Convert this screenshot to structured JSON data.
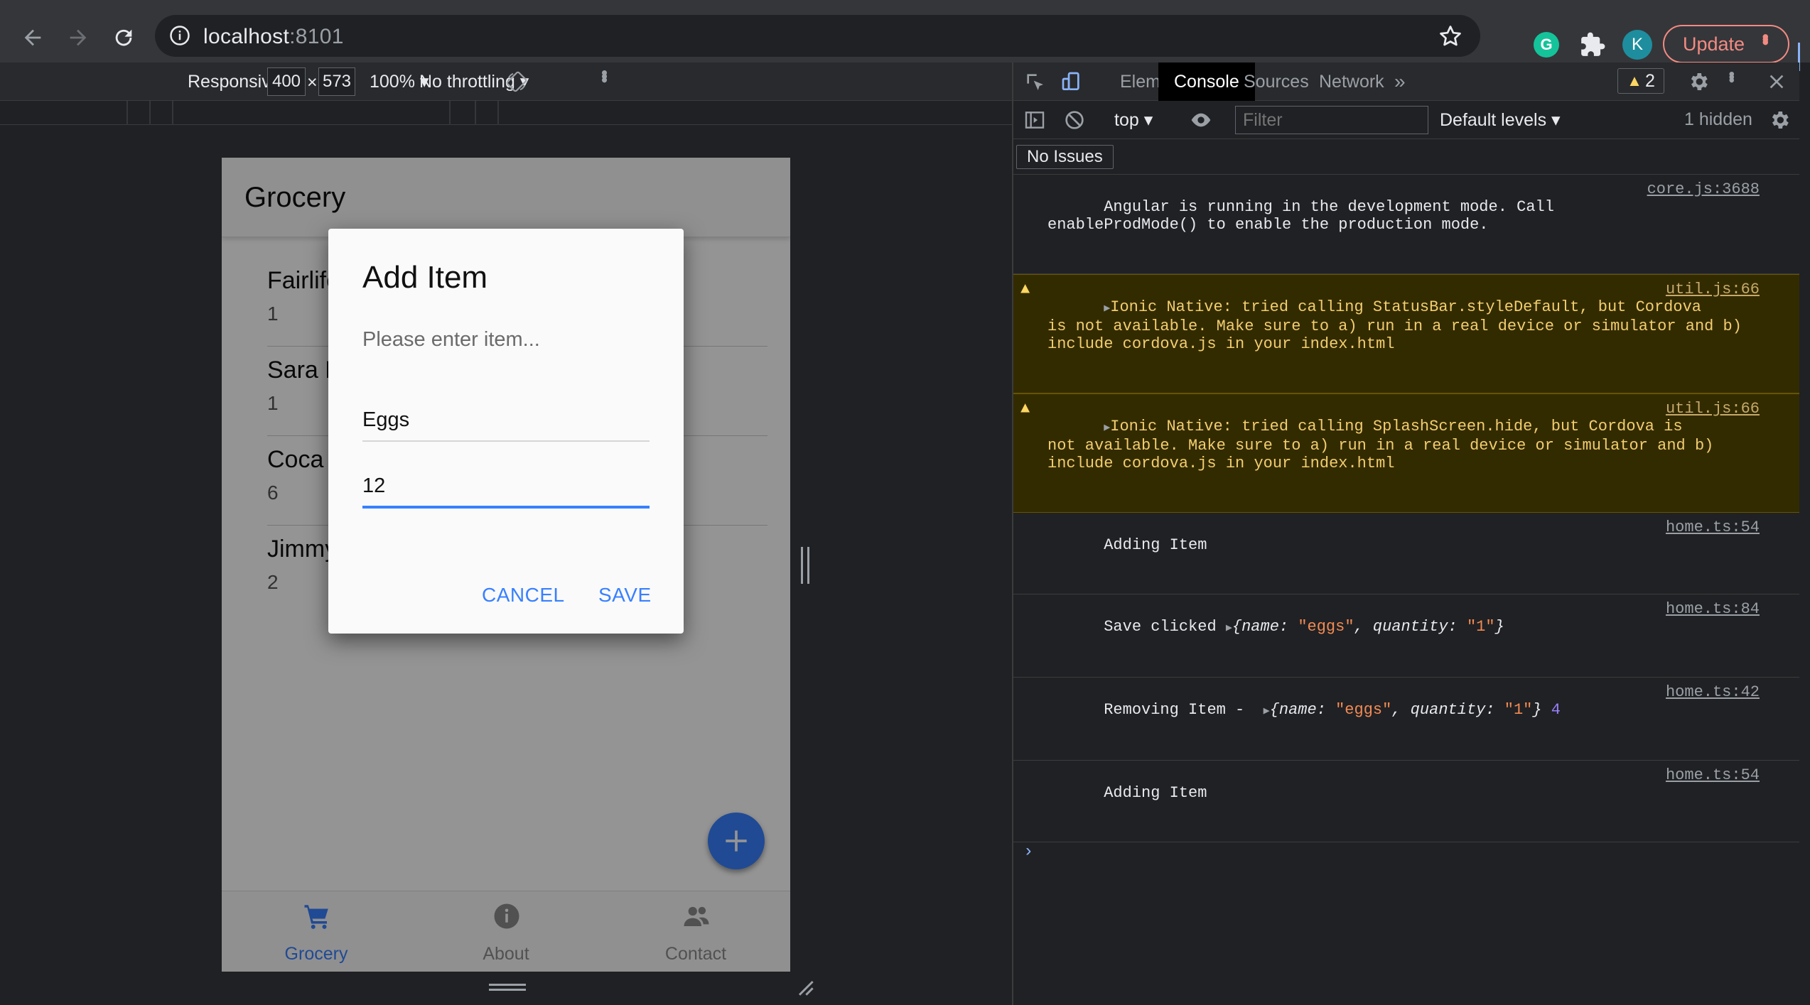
{
  "browser": {
    "url_host": "localhost",
    "url_port": ":8101",
    "extension_grammarly": "G",
    "profile_initial": "K",
    "update_label": "Update"
  },
  "device_toolbar": {
    "mode": "Responsive",
    "width": "400",
    "height": "573",
    "times": "×",
    "zoom": "100%",
    "throttling": "No throttling"
  },
  "app": {
    "title": "Grocery",
    "items": [
      {
        "name": "Fairlife",
        "qty": "1"
      },
      {
        "name": "Sara L",
        "qty": "1"
      },
      {
        "name": "Coca C",
        "qty": "6"
      },
      {
        "name": "Jimmy",
        "qty": "2"
      }
    ],
    "tabs": [
      {
        "label": "Grocery",
        "icon": "cart-icon",
        "active": true
      },
      {
        "label": "About",
        "icon": "info-icon",
        "active": false
      },
      {
        "label": "Contact",
        "icon": "people-icon",
        "active": false
      }
    ],
    "accent": "#3880ff"
  },
  "dialog": {
    "title": "Add Item",
    "message": "Please enter item...",
    "name_value": "Eggs",
    "qty_value": "12",
    "cancel": "CANCEL",
    "save": "SAVE"
  },
  "devtools": {
    "tabs": [
      "Elements",
      "Console",
      "Sources",
      "Network"
    ],
    "active_tab": "Console",
    "more": "»",
    "warning_count": "2",
    "context": "top",
    "filter_placeholder": "Filter",
    "levels": "Default levels",
    "hidden": "1 hidden",
    "issues": "No Issues",
    "messages": [
      {
        "type": "log",
        "text": "Angular is running in the development mode. Call\nenableProdMode() to enable the production mode.",
        "source": "core.js:3688"
      },
      {
        "type": "warn",
        "text": "Ionic Native: tried calling StatusBar.styleDefault, but Cordova\nis not available. Make sure to a) run in a real device or simulator and b)\ninclude cordova.js in your index.html",
        "source": "util.js:66"
      },
      {
        "type": "warn",
        "text": "Ionic Native: tried calling SplashScreen.hide, but Cordova is\nnot available. Make sure to a) run in a real device or simulator and b)\ninclude cordova.js in your index.html",
        "source": "util.js:66"
      },
      {
        "type": "log",
        "text": "Adding Item",
        "source": "home.ts:54"
      },
      {
        "type": "obj",
        "prefix": "Save clicked ",
        "obj_name": "\"eggs\"",
        "obj_qty": "\"1\"",
        "suffix": "",
        "source": "home.ts:84"
      },
      {
        "type": "obj",
        "prefix": "Removing Item -  ",
        "obj_name": "\"eggs\"",
        "obj_qty": "\"1\"",
        "suffix": " 4",
        "source": "home.ts:42"
      },
      {
        "type": "log",
        "text": "Adding Item",
        "source": "home.ts:54"
      }
    ],
    "prompt": "›"
  }
}
